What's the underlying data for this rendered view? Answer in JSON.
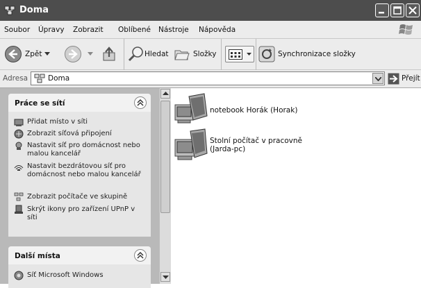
{
  "window": {
    "title": "Doma"
  },
  "menubar": [
    "Soubor",
    "Úpravy",
    "Zobrazit",
    "Oblíbené",
    "Nástroje",
    "Nápověda"
  ],
  "toolbar": {
    "back_label": "Zpět",
    "search_label": "Hledat",
    "folders_label": "Složky",
    "sync_label": "Synchronizace složky"
  },
  "address": {
    "label": "Adresa",
    "value": "Doma",
    "go_label": "Přejít"
  },
  "network_tasks": {
    "title": "Práce se sítí",
    "items": [
      "Přidat místo v síti",
      "Zobrazit síťová připojení",
      "Nastavit síť pro domácnost nebo malou kancelář",
      "Nastavit bezdrátovou síť pro domácnost nebo malou kancelář",
      "Zobrazit počítače ve skupině",
      "Skrýt ikony pro zařízení UPnP v síti"
    ]
  },
  "other_places": {
    "title": "Další místa",
    "items": [
      "Síť Microsoft Windows"
    ]
  },
  "computers": [
    "notebook Horák (Horak)",
    "Stolní počítač v pracovně (Jarda-pc)"
  ]
}
